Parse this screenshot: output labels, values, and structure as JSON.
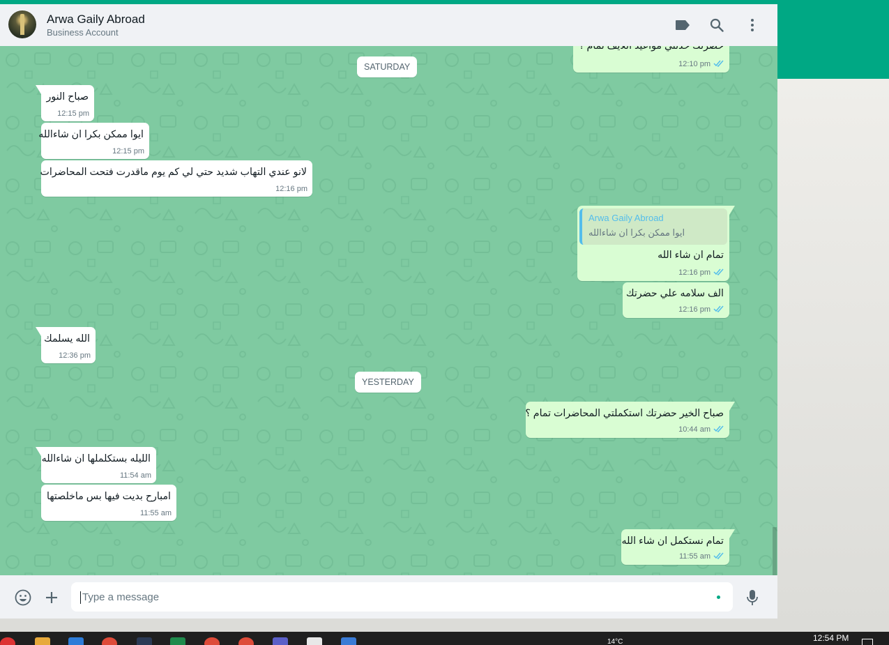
{
  "header": {
    "name": "Arwa Gaily Abroad",
    "subtitle": "Business Account",
    "icons": [
      "label-icon",
      "search-icon",
      "menu-icon"
    ]
  },
  "chat": {
    "top_partial": {
      "text": "حضرتك حدثني مواعيد اللايف تمام ؟",
      "time": "12:10 pm"
    },
    "date_saturday": "SATURDAY",
    "m1": {
      "text": "صباح النور",
      "time": "12:15 pm"
    },
    "m2": {
      "text": "ايوا ممكن بكرا ان شاءالله",
      "time": "12:15 pm"
    },
    "m3": {
      "text": "لانو عندي التهاب شديد حتي لي كم يوم ماقدرت فتحت المحاضرات",
      "time": "12:16 pm"
    },
    "m4": {
      "quote_name": "Arwa Gaily Abroad",
      "quote_text": "ايوا ممكن بكرا ان شاءالله",
      "text": "تمام ان شاء الله",
      "time": "12:16 pm"
    },
    "m5": {
      "text": "الف سلامه علي حضرتك",
      "time": "12:16 pm"
    },
    "m6": {
      "text": "الله يسلمك",
      "time": "12:36 pm"
    },
    "date_yesterday": "YESTERDAY",
    "m7": {
      "text": "صباح الخير حضرتك استكملتي المحاضرات تمام ؟",
      "time": "10:44 am"
    },
    "m8": {
      "text": "الليله بستكلملها ان شاءالله",
      "time": "11:54 am"
    },
    "m9": {
      "text": "امبارح بديت فيها بس ماخلصتها",
      "time": "11:55 am"
    },
    "m10": {
      "text": "تمام نستكمل ان شاء الله",
      "time": "11:55 am"
    }
  },
  "composer": {
    "placeholder": "Type a message"
  },
  "taskbar": {
    "weather": "14°C",
    "clock": "12:54 PM"
  },
  "colors": {
    "accent": "#00a884",
    "chat_bg": "#7fcaa1",
    "incoming": "#ffffff",
    "outgoing": "#d9fdd3",
    "read_ticks": "#53bdeb"
  }
}
